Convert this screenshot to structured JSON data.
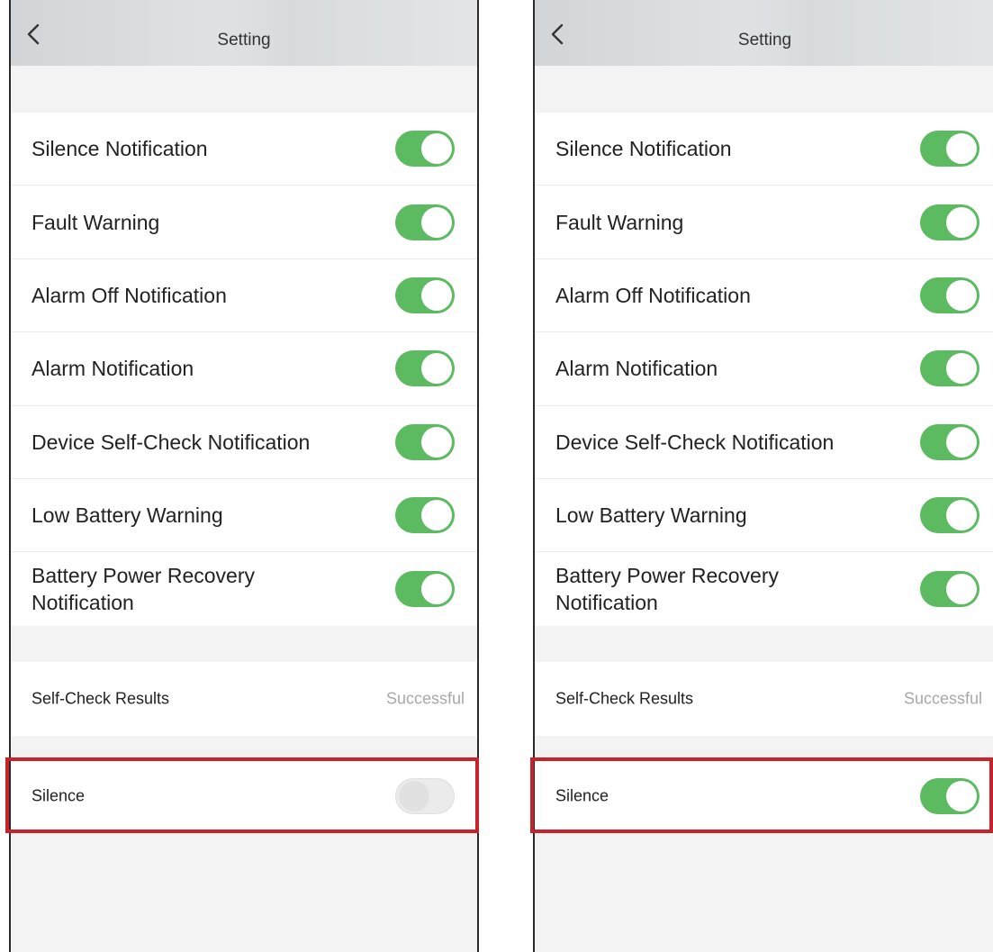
{
  "screens": [
    {
      "id": "before",
      "nav": {
        "title": "Setting",
        "back_icon": "chevron-left-icon"
      },
      "toggles": [
        {
          "label": "Silence Notification",
          "on": true
        },
        {
          "label": "Fault Warning",
          "on": true
        },
        {
          "label": "Alarm Off Notification",
          "on": true
        },
        {
          "label": "Alarm Notification",
          "on": true
        },
        {
          "label": "Device Self-Check Notification",
          "on": true
        },
        {
          "label": "Low Battery Warning",
          "on": true
        },
        {
          "label": "Battery Power Recovery Notification",
          "on": true
        }
      ],
      "self_check": {
        "label": "Self-Check Results",
        "value": "Successful"
      },
      "silence": {
        "label": "Silence",
        "on": false
      }
    },
    {
      "id": "after",
      "nav": {
        "title": "Setting",
        "back_icon": "chevron-left-icon"
      },
      "toggles": [
        {
          "label": "Silence Notification",
          "on": true
        },
        {
          "label": "Fault Warning",
          "on": true
        },
        {
          "label": "Alarm Off Notification",
          "on": true
        },
        {
          "label": "Alarm Notification",
          "on": true
        },
        {
          "label": "Device Self-Check Notification",
          "on": true
        },
        {
          "label": "Low Battery Warning",
          "on": true
        },
        {
          "label": "Battery Power Recovery Notification",
          "on": true
        }
      ],
      "self_check": {
        "label": "Self-Check Results",
        "value": "Successful"
      },
      "silence": {
        "label": "Silence",
        "on": true
      }
    }
  ],
  "colors": {
    "toggle_on": "#5cba60",
    "toggle_off": "#ebebeb",
    "highlight": "#c8222a",
    "muted_text": "#a8a8a8"
  }
}
